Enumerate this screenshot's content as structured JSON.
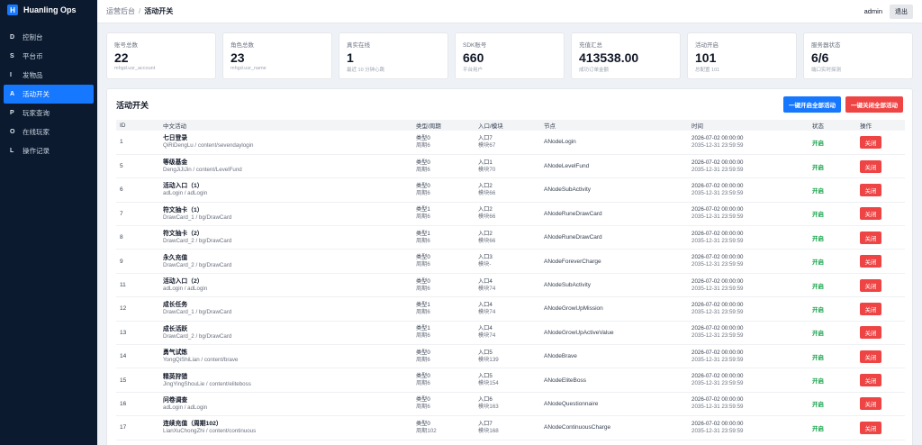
{
  "brand": {
    "logo_letter": "H",
    "name": "Huanling Ops"
  },
  "nav": [
    {
      "icon": "D",
      "label": "控制台",
      "active": false
    },
    {
      "icon": "S",
      "label": "平台币",
      "active": false
    },
    {
      "icon": "I",
      "label": "发物品",
      "active": false
    },
    {
      "icon": "A",
      "label": "活动开关",
      "active": true
    },
    {
      "icon": "P",
      "label": "玩家查询",
      "active": false
    },
    {
      "icon": "O",
      "label": "在线玩家",
      "active": false
    },
    {
      "icon": "L",
      "label": "操作记录",
      "active": false
    }
  ],
  "header": {
    "crumb_root": "运营后台",
    "crumb_sep": "/",
    "crumb_current": "活动开关",
    "user": "admin",
    "logout": "退出"
  },
  "stats": [
    {
      "label": "账号总数",
      "value": "22",
      "sub": "mhgd.usr_account"
    },
    {
      "label": "角色总数",
      "value": "23",
      "sub": "mhgd.usr_name"
    },
    {
      "label": "真实在线",
      "value": "1",
      "sub": "最近 10 分钟心跳"
    },
    {
      "label": "SDK账号",
      "value": "660",
      "sub": "平台用户"
    },
    {
      "label": "充值汇总",
      "value": "413538.00",
      "sub": "成功订单金额"
    },
    {
      "label": "活动开启",
      "value": "101",
      "sub": "总配置 101"
    },
    {
      "label": "服务器状态",
      "value": "6/6",
      "sub": "端口实时探测"
    }
  ],
  "panel": {
    "title": "活动开关",
    "open_all": "一键开启全部活动",
    "close_all": "一键关闭全部活动"
  },
  "columns": [
    "ID",
    "中文活动",
    "类型/周期",
    "入口/模块",
    "节点",
    "时间",
    "状态",
    "操作"
  ],
  "rows": [
    {
      "id": "1",
      "name": "七日登录",
      "path": "QiRiDengLu / content/sevendaylogin",
      "type": "类型0",
      "period": "周期6",
      "entry": "入口7",
      "module": "模块67",
      "node": "ANodeLogin",
      "start": "2026-07-02 00:00:00",
      "end": "2035-12-31 23:59:59",
      "status": "开启",
      "action": "关闭"
    },
    {
      "id": "5",
      "name": "等级基金",
      "path": "DengJiJiJin / content/LevelFund",
      "type": "类型0",
      "period": "周期6",
      "entry": "入口1",
      "module": "模块70",
      "node": "ANodeLevelFund",
      "start": "2026-07-02 00:00:00",
      "end": "2035-12-31 23:59:59",
      "status": "开启",
      "action": "关闭"
    },
    {
      "id": "6",
      "name": "活动入口（1）",
      "path": "adLogin / adLogin",
      "type": "类型0",
      "period": "周期6",
      "entry": "入口2",
      "module": "模块66",
      "node": "ANodeSubActivity",
      "start": "2026-07-02 00:00:00",
      "end": "2035-12-31 23:59:59",
      "status": "开启",
      "action": "关闭"
    },
    {
      "id": "7",
      "name": "符文抽卡（1）",
      "path": "DrawCard_1 / bg/DrawCard",
      "type": "类型1",
      "period": "周期6",
      "entry": "入口2",
      "module": "模块66",
      "node": "ANodeRuneDrawCard",
      "start": "2026-07-02 00:00:00",
      "end": "2035-12-31 23:59:59",
      "status": "开启",
      "action": "关闭"
    },
    {
      "id": "8",
      "name": "符文抽卡（2）",
      "path": "DrawCard_2 / bg/DrawCard",
      "type": "类型1",
      "period": "周期6",
      "entry": "入口2",
      "module": "模块66",
      "node": "ANodeRuneDrawCard",
      "start": "2026-07-02 00:00:00",
      "end": "2035-12-31 23:59:59",
      "status": "开启",
      "action": "关闭"
    },
    {
      "id": "9",
      "name": "永久充值",
      "path": "DrawCard_2 / bg/DrawCard",
      "type": "类型0",
      "period": "周期6",
      "entry": "入口3",
      "module": "模块-",
      "node": "ANodeForeverCharge",
      "start": "2026-07-02 00:00:00",
      "end": "2035-12-31 23:59:59",
      "status": "开启",
      "action": "关闭"
    },
    {
      "id": "11",
      "name": "活动入口（2）",
      "path": "adLogin / adLogin",
      "type": "类型0",
      "period": "周期6",
      "entry": "入口4",
      "module": "模块74",
      "node": "ANodeSubActivity",
      "start": "2026-07-02 00:00:00",
      "end": "2035-12-31 23:59:59",
      "status": "开启",
      "action": "关闭"
    },
    {
      "id": "12",
      "name": "成长任务",
      "path": "DrawCard_1 / bg/DrawCard",
      "type": "类型1",
      "period": "周期6",
      "entry": "入口4",
      "module": "模块74",
      "node": "ANodeGrowUpMission",
      "start": "2026-07-02 00:00:00",
      "end": "2035-12-31 23:59:59",
      "status": "开启",
      "action": "关闭"
    },
    {
      "id": "13",
      "name": "成长活跃",
      "path": "DrawCard_2 / bg/DrawCard",
      "type": "类型1",
      "period": "周期6",
      "entry": "入口4",
      "module": "模块74",
      "node": "ANodeGrowUpActiveValue",
      "start": "2026-07-02 00:00:00",
      "end": "2035-12-31 23:59:59",
      "status": "开启",
      "action": "关闭"
    },
    {
      "id": "14",
      "name": "勇气试炼",
      "path": "YongQiShiLian / content/brave",
      "type": "类型0",
      "period": "周期6",
      "entry": "入口5",
      "module": "模块139",
      "node": "ANodeBrave",
      "start": "2026-07-02 00:00:00",
      "end": "2035-12-31 23:59:59",
      "status": "开启",
      "action": "关闭"
    },
    {
      "id": "15",
      "name": "精英狩猎",
      "path": "JingYingShouLie / content/eliteboss",
      "type": "类型0",
      "period": "周期6",
      "entry": "入口5",
      "module": "模块154",
      "node": "ANodeEliteBoss",
      "start": "2026-07-02 00:00:00",
      "end": "2035-12-31 23:59:59",
      "status": "开启",
      "action": "关闭"
    },
    {
      "id": "16",
      "name": "问卷调查",
      "path": "adLogin / adLogin",
      "type": "类型0",
      "period": "周期6",
      "entry": "入口6",
      "module": "模块163",
      "node": "ANodeQuestionnaire",
      "start": "2026-07-02 00:00:00",
      "end": "2035-12-31 23:59:59",
      "status": "开启",
      "action": "关闭"
    },
    {
      "id": "17",
      "name": "连续充值（周期102）",
      "path": "LianXuChongZhi / content/continuous",
      "type": "类型0",
      "period": "周期102",
      "entry": "入口7",
      "module": "模块168",
      "node": "ANodeContinuousCharge",
      "start": "2026-07-02 00:00:00",
      "end": "2035-12-31 23:59:59",
      "status": "开启",
      "action": "关闭"
    }
  ]
}
